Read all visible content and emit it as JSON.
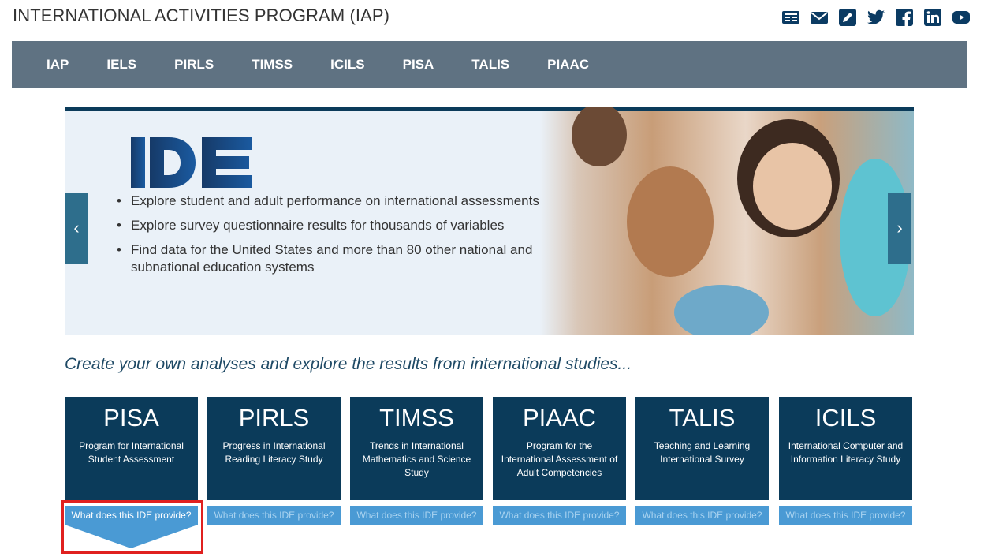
{
  "header": {
    "site_title": "INTERNATIONAL ACTIVITIES PROGRAM (IAP)",
    "social_icons": [
      "news-icon",
      "mail-icon",
      "edit-icon",
      "twitter-icon",
      "facebook-icon",
      "linkedin-icon",
      "youtube-icon"
    ]
  },
  "nav": {
    "items": [
      "IAP",
      "IELS",
      "PIRLS",
      "TIMSS",
      "ICILS",
      "PISA",
      "TALIS",
      "PIAAC"
    ]
  },
  "hero": {
    "logo_text": "IDE",
    "bullets": [
      "Explore student and adult performance on international assessments",
      "Explore survey questionnaire results for thousands of variables",
      "Find data for the United States and more than 80 other national and subnational education systems"
    ],
    "prev_label": "‹",
    "next_label": "›"
  },
  "tagline": "Create your own analyses and explore the results from international studies...",
  "cards": [
    {
      "abbr": "PISA",
      "full": "Program for International Student Assessment",
      "provide": "What does this IDE provide?"
    },
    {
      "abbr": "PIRLS",
      "full": "Progress in International Reading Literacy Study",
      "provide": "What does this IDE provide?"
    },
    {
      "abbr": "TIMSS",
      "full": "Trends in International Mathematics and Science Study",
      "provide": "What does this IDE provide?"
    },
    {
      "abbr": "PIAAC",
      "full": "Program for the International Assessment of Adult Competencies",
      "provide": "What does this IDE provide?"
    },
    {
      "abbr": "TALIS",
      "full": "Teaching and Learning International Survey",
      "provide": "What does this IDE provide?"
    },
    {
      "abbr": "ICILS",
      "full": "International Computer and Information Literacy Study",
      "provide": "What does this IDE provide?"
    }
  ],
  "colors": {
    "dark_navy": "#0b3b5a",
    "nav_bg": "#5f7282",
    "provide_blue": "#4a9ad4",
    "highlight_red": "#e0201f"
  }
}
